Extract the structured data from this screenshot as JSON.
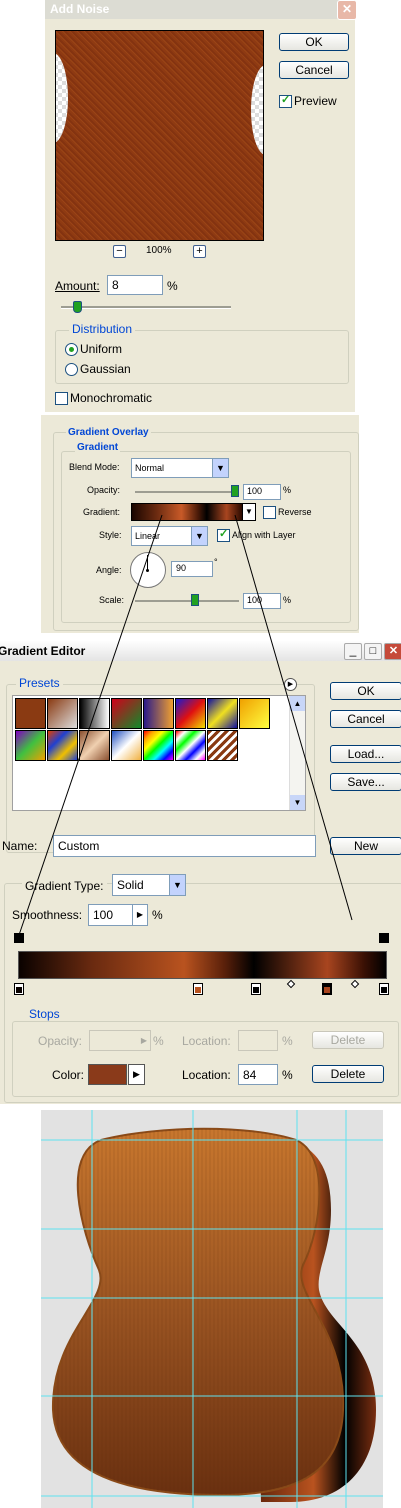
{
  "add_noise": {
    "title": "Add Noise",
    "ok_label": "OK",
    "cancel_label": "Cancel",
    "preview_label": "Preview",
    "zoom_text": "100%",
    "zoom_minus": "−",
    "zoom_plus": "+",
    "amount_label": "Amount:",
    "amount_value": "8",
    "amount_unit": "%",
    "amount_slider_fraction": 0.08,
    "distribution_label": "Distribution",
    "uniform_label": "Uniform",
    "gaussian_label": "Gaussian",
    "selected_distribution": "Uniform",
    "monochromatic_label": "Monochromatic",
    "preview_color": "#8e3a12"
  },
  "gradient_overlay": {
    "title": "Gradient Overlay",
    "subtitle": "Gradient",
    "blend_mode_label": "Blend Mode:",
    "blend_mode_value": "Normal",
    "opacity_label": "Opacity:",
    "opacity_value": "100",
    "opacity_unit": "%",
    "gradient_label": "Gradient:",
    "reverse_label": "Reverse",
    "style_label": "Style:",
    "style_value": "Linear",
    "align_label": "Align with Layer",
    "angle_label": "Angle:",
    "angle_value": "90",
    "angle_unit": "°",
    "scale_label": "Scale:",
    "scale_value": "100",
    "scale_unit": "%"
  },
  "gradient_editor": {
    "title": "Gradient Editor",
    "presets_label": "Presets",
    "ok_label": "OK",
    "cancel_label": "Cancel",
    "load_label": "Load...",
    "save_label": "Save...",
    "name_label": "Name:",
    "name_value": "Custom",
    "new_label": "New",
    "gradient_type_label": "Gradient Type:",
    "gradient_type_value": "Solid",
    "smoothness_label": "Smoothness:",
    "smoothness_value": "100",
    "smoothness_unit": "%",
    "stops_label": "Stops",
    "opacity_label": "Opacity:",
    "opacity_unit": "%",
    "location_label": "Location:",
    "location_unit": "%",
    "delete_label": "Delete",
    "color_label": "Color:",
    "color_location_value": "84",
    "stop_color": "#8a3a1a"
  },
  "guitar": {
    "background": "#e2e2e2",
    "guide_color": "#5fe3f0"
  }
}
